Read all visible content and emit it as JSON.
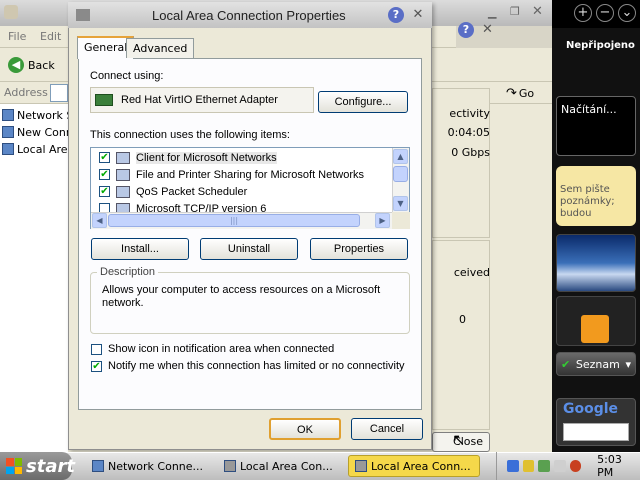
{
  "background_window": {
    "menu": [
      "File",
      "Edit"
    ],
    "back_label": "Back",
    "address_label": "Address",
    "go_label": "Go",
    "list_items": [
      "Network S",
      "New Conn",
      "Local Area"
    ],
    "status_labels": [
      "ectivity",
      "0:04:05",
      "0 Gbps"
    ],
    "activity_labels": [
      "ceived",
      "0"
    ],
    "close_label": "Close"
  },
  "sidebar": {
    "status": "Nepřipojeno",
    "loading": "Načítání...",
    "notes_text": "Sem pište poznámky; budou",
    "seznam_label": "Seznam",
    "google_label": "Google"
  },
  "dialog": {
    "title": "Local Area Connection Properties",
    "help": "?",
    "close": "✕",
    "tabs": [
      "General",
      "Advanced"
    ],
    "connect_using_label": "Connect using:",
    "adapter_name": "Red Hat VirtIO Ethernet Adapter",
    "configure_label": "Configure...",
    "items_label": "This connection uses the following items:",
    "items": [
      {
        "label": "Client for Microsoft Networks",
        "checked": true
      },
      {
        "label": "File and Printer Sharing for Microsoft Networks",
        "checked": true
      },
      {
        "label": "QoS Packet Scheduler",
        "checked": true
      },
      {
        "label": "Microsoft TCP/IP version 6",
        "checked": false
      }
    ],
    "install_label": "Install...",
    "uninstall_label": "Uninstall",
    "properties_label": "Properties",
    "description_legend": "Description",
    "description_text": "Allows your computer to access resources on a Microsoft network.",
    "show_icon_label": "Show icon in notification area when connected",
    "show_icon_checked": false,
    "notify_label": "Notify me when this connection has limited or no connectivity",
    "notify_checked": true,
    "ok_label": "OK",
    "cancel_label": "Cancel"
  },
  "taskbar": {
    "start_label": "start",
    "tasks": [
      "Network Conne...",
      "Local Area Con...",
      "Local Area Conn..."
    ],
    "clock": "5:03 PM"
  },
  "colors": {
    "accent": "#e6a33a",
    "active_task": "#f5d84a"
  }
}
